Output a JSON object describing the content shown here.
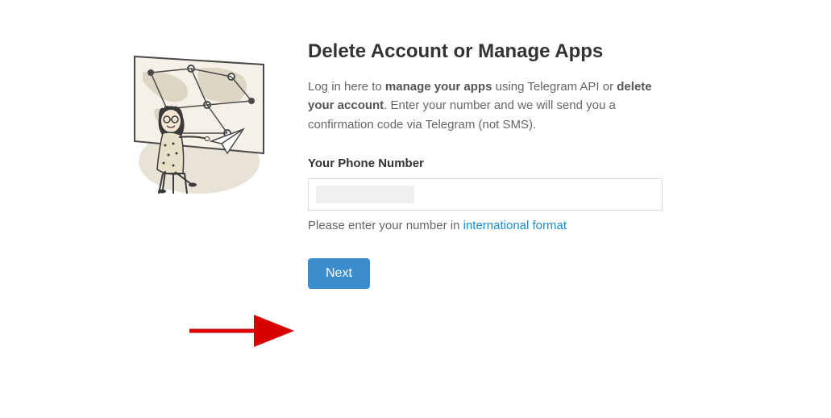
{
  "page": {
    "title": "Delete Account or Manage Apps",
    "desc_part1": "Log in here to ",
    "desc_strong1": "manage your apps",
    "desc_part2": " using Telegram API or ",
    "desc_strong2": "delete your account",
    "desc_part3": ". Enter your number and we will send you a confirmation code via Telegram (not SMS).",
    "field_label": "Your Phone Number",
    "phone_value": "",
    "helper_prefix": "Please enter your number in ",
    "helper_link": "international format",
    "next_label": "Next"
  }
}
